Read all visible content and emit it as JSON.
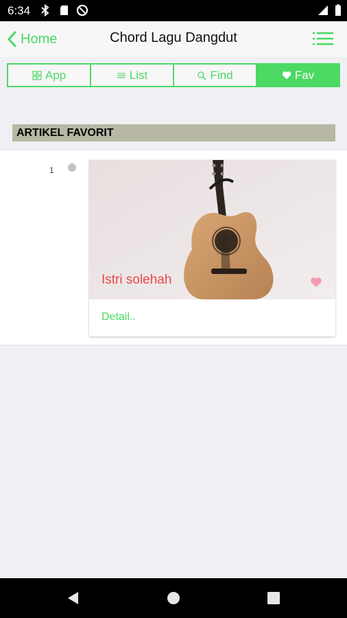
{
  "status_bar": {
    "time": "6:34"
  },
  "nav": {
    "back_label": "Home",
    "title": "Chord Lagu Dangdut"
  },
  "tabs": [
    {
      "label": "App",
      "icon": "grid-icon"
    },
    {
      "label": "List",
      "icon": "list-icon"
    },
    {
      "label": "Find",
      "icon": "search-icon"
    },
    {
      "label": "Fav",
      "icon": "heart-icon"
    }
  ],
  "active_tab": "Fav",
  "section": {
    "header": "ARTIKEL FAVORIT"
  },
  "items": [
    {
      "number": "1",
      "title": "Istri solehah",
      "detail_label": "Detail.."
    }
  ],
  "colors": {
    "accent": "#4cd964",
    "title_red": "#e8484a",
    "header_bg": "#b7b7a4"
  }
}
